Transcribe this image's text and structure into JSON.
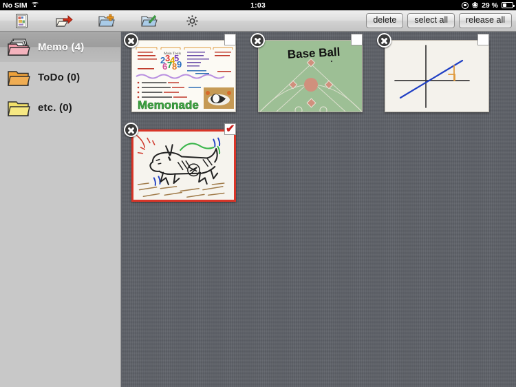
{
  "statusbar": {
    "carrier": "No SIM",
    "wifi_icon": "wifi-icon",
    "time": "1:03",
    "rotation_lock_icon": "rotation-lock-icon",
    "bluetooth_icon": "bluetooth-icon",
    "battery_percent": "29 %",
    "battery_icon": "battery-icon"
  },
  "toolbar": {
    "icons": [
      {
        "name": "memo-list-icon",
        "title": "memo"
      },
      {
        "name": "export-icon",
        "title": "export"
      },
      {
        "name": "add-folder-icon",
        "title": "add folder"
      },
      {
        "name": "edit-folder-icon",
        "title": "edit folder"
      },
      {
        "name": "gear-icon",
        "title": "settings"
      }
    ],
    "delete_label": "delete",
    "select_all_label": "select all",
    "release_all_label": "release all"
  },
  "sidebar": {
    "items": [
      {
        "label": "Memo (4)",
        "name": "Memo",
        "count": 4,
        "color": "#f29cab",
        "selected": true
      },
      {
        "label": "ToDo (0)",
        "name": "ToDo",
        "count": 0,
        "color": "#eda13a",
        "selected": false
      },
      {
        "label": "etc. (0)",
        "name": "etc.",
        "count": 0,
        "color": "#f2e06a",
        "selected": false
      }
    ]
  },
  "memos": [
    {
      "id": "memo-memonade",
      "kind": "notes-page",
      "title_text": "Memonade",
      "selected": false,
      "checked": false,
      "bullets": [
        "You can take memo Easily.",
        "When you draw dotted Long Press or Zoom Scale.",
        "Use Slim Tool Copy Cut & Pastes.",
        "All memos Can be Seen, in Details View."
      ],
      "columns": [
        [
          "Export",
          "New Memo",
          "Delete & Clear",
          "Details View"
        ],
        [
          "Main Tools"
        ],
        [
          "Text Input",
          "Put Picture",
          "Select Background Image",
          "Common",
          "Slim Tool",
          "Japanese Speak Recognize"
        ],
        [
          "Previous Page",
          "Next Page",
          "Slim Mode"
        ]
      ]
    },
    {
      "id": "memo-baseball",
      "kind": "baseball-field",
      "title_text": "Base Ball",
      "selected": false,
      "checked": false
    },
    {
      "id": "memo-graph",
      "kind": "graph-axes",
      "title_text": "",
      "selected": false,
      "checked": false
    },
    {
      "id": "memo-dog",
      "kind": "dog-sketch",
      "title_text": "",
      "selected": true,
      "checked": true
    }
  ],
  "colors": {
    "background": "#5e6168",
    "sidebar": "#c8c8c8",
    "selection_border": "#d93528",
    "check_mark": "#c9211e",
    "toolbar_top": "#efefef"
  }
}
